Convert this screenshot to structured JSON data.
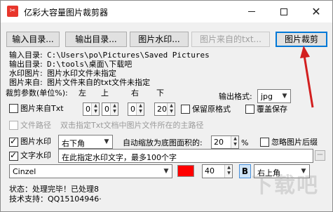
{
  "window": {
    "title": "亿彩大容量图片裁剪器",
    "icon": "app-logo-icon",
    "controls": [
      "minimize-icon",
      "maximize-icon",
      "close-icon"
    ]
  },
  "toolbar": {
    "input_dir": "输入目录...",
    "output_dir": "输出目录...",
    "image_watermark": "图片水印...",
    "image_from_txt": "图片来自的txt...",
    "crop": "图片裁剪"
  },
  "info": {
    "input_dir_label": "输入目录:",
    "input_dir_value": "C:\\Users\\po\\Pictures\\Saved Pictures",
    "output_dir_label": "输出目录:",
    "output_dir_value": "D:\\tools\\桌面\\下载吧",
    "watermark_label": "水印图片:",
    "watermark_value": "图片水印文件未指定",
    "source_label": "图片来自:",
    "source_value": "图片文件来自的txt文件未指定"
  },
  "crop_params": {
    "label": "裁剪参数(单位%):",
    "left": "左",
    "top": "上",
    "right": "右",
    "bottom": "下",
    "output_format_label": "输出格式:",
    "output_format_value": "jpg"
  },
  "options": {
    "from_txt_label": "图片来自Txt",
    "v_left": "0",
    "v_top": "0",
    "v_right": "0",
    "v_bottom": "20",
    "keep_format": "保留原格式",
    "overwrite": "覆盖保存",
    "file_path": "文件路径",
    "file_path_hint": "双击指定Txt文档中图片文件所在的主路径"
  },
  "watermark": {
    "image_label": "图片水印",
    "position_value": "右下角",
    "scale_label": "自动缩放为底图面积的:",
    "scale_value": "20",
    "scale_unit": "%",
    "ignore_later": "忽略图片后缀",
    "text_label": "文字水印",
    "text_placeholder": "在此指定水印文字，最多100个字",
    "font_value": "Cinzel",
    "font_size": "40",
    "bold_label": "B",
    "text_position_value": "右上角",
    "color": "#ff0000"
  },
  "status": {
    "line1": "状态：处理完毕！已处理8",
    "line2": "技术支持：QQ15104946·"
  },
  "watermark_logo": "下载吧"
}
